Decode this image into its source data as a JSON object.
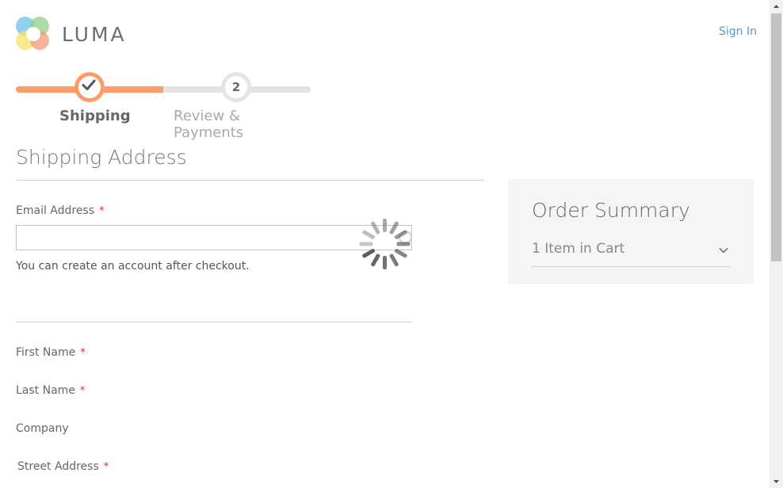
{
  "header": {
    "logo_text": "LUMA",
    "sign_in": "Sign In"
  },
  "progress": {
    "steps": [
      {
        "label": "Shipping",
        "status": "complete",
        "icon": "check-icon"
      },
      {
        "label": "Review & Payments",
        "number": "2",
        "status": "pending"
      }
    ]
  },
  "shipping": {
    "title": "Shipping Address",
    "required_marker": "*",
    "email_label": "Email Address",
    "email_value": "",
    "email_note": "You can create an account after checkout.",
    "first_name_label": "First Name",
    "last_name_label": "Last Name",
    "company_label": "Company",
    "street_label": "Street Address"
  },
  "order_summary": {
    "title": "Order Summary",
    "items_label": "1 Item in Cart"
  },
  "colors": {
    "accent": "#ff9c66",
    "link": "#6294c9",
    "required": "#e02b27",
    "summary_bg": "#f5f5f5"
  },
  "loading": true
}
